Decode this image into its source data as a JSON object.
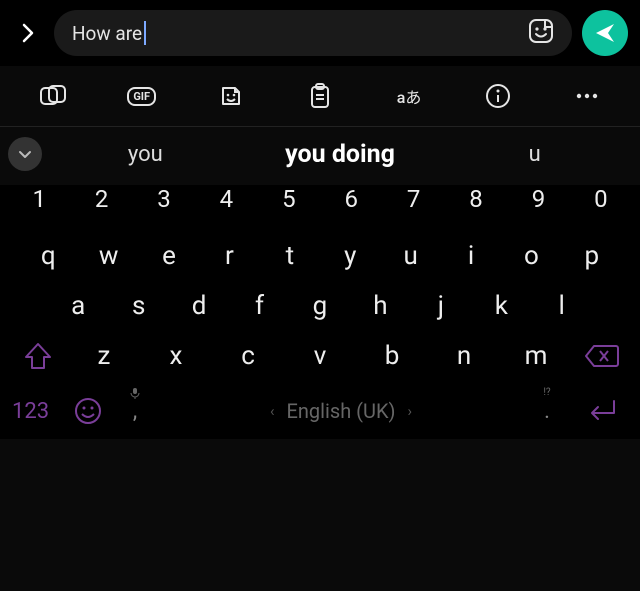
{
  "input": {
    "text": "How are "
  },
  "suggestions": {
    "left": "you",
    "center": "you doing",
    "right": "u"
  },
  "keyboard": {
    "numbers": [
      "1",
      "2",
      "3",
      "4",
      "5",
      "6",
      "7",
      "8",
      "9",
      "0"
    ],
    "row1": [
      "q",
      "w",
      "e",
      "r",
      "t",
      "y",
      "u",
      "i",
      "o",
      "p"
    ],
    "row2": [
      "a",
      "s",
      "d",
      "f",
      "g",
      "h",
      "j",
      "k",
      "l"
    ],
    "row3": [
      "z",
      "x",
      "c",
      "v",
      "b",
      "n",
      "m"
    ]
  },
  "bottom": {
    "symbols": "123",
    "comma": ",",
    "period": ".",
    "mic_hint": "",
    "qmark_hint": "!?",
    "language": "English (UK)"
  },
  "toolbar": {
    "gif_label": "GIF",
    "translate_label": "aあ"
  },
  "colors": {
    "accent_send": "#0dc29e",
    "accent_purple": "#7a3e99"
  }
}
